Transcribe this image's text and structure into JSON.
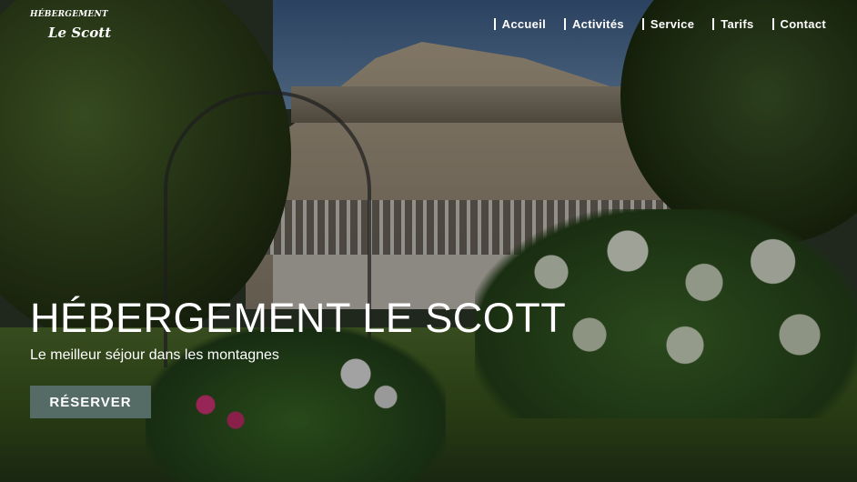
{
  "brand": {
    "line1": "HÉBERGEMENT",
    "line2": "Le Scott"
  },
  "nav": {
    "items": [
      "Accueil",
      "Activités",
      "Service",
      "Tarifs",
      "Contact"
    ]
  },
  "hero": {
    "title": "HÉBERGEMENT LE SCOTT",
    "subtitle": "Le meilleur séjour dans les montagnes",
    "button_label": "RÉSERVER"
  },
  "colors": {
    "button_bg": "#546b66",
    "text": "#ffffff"
  }
}
